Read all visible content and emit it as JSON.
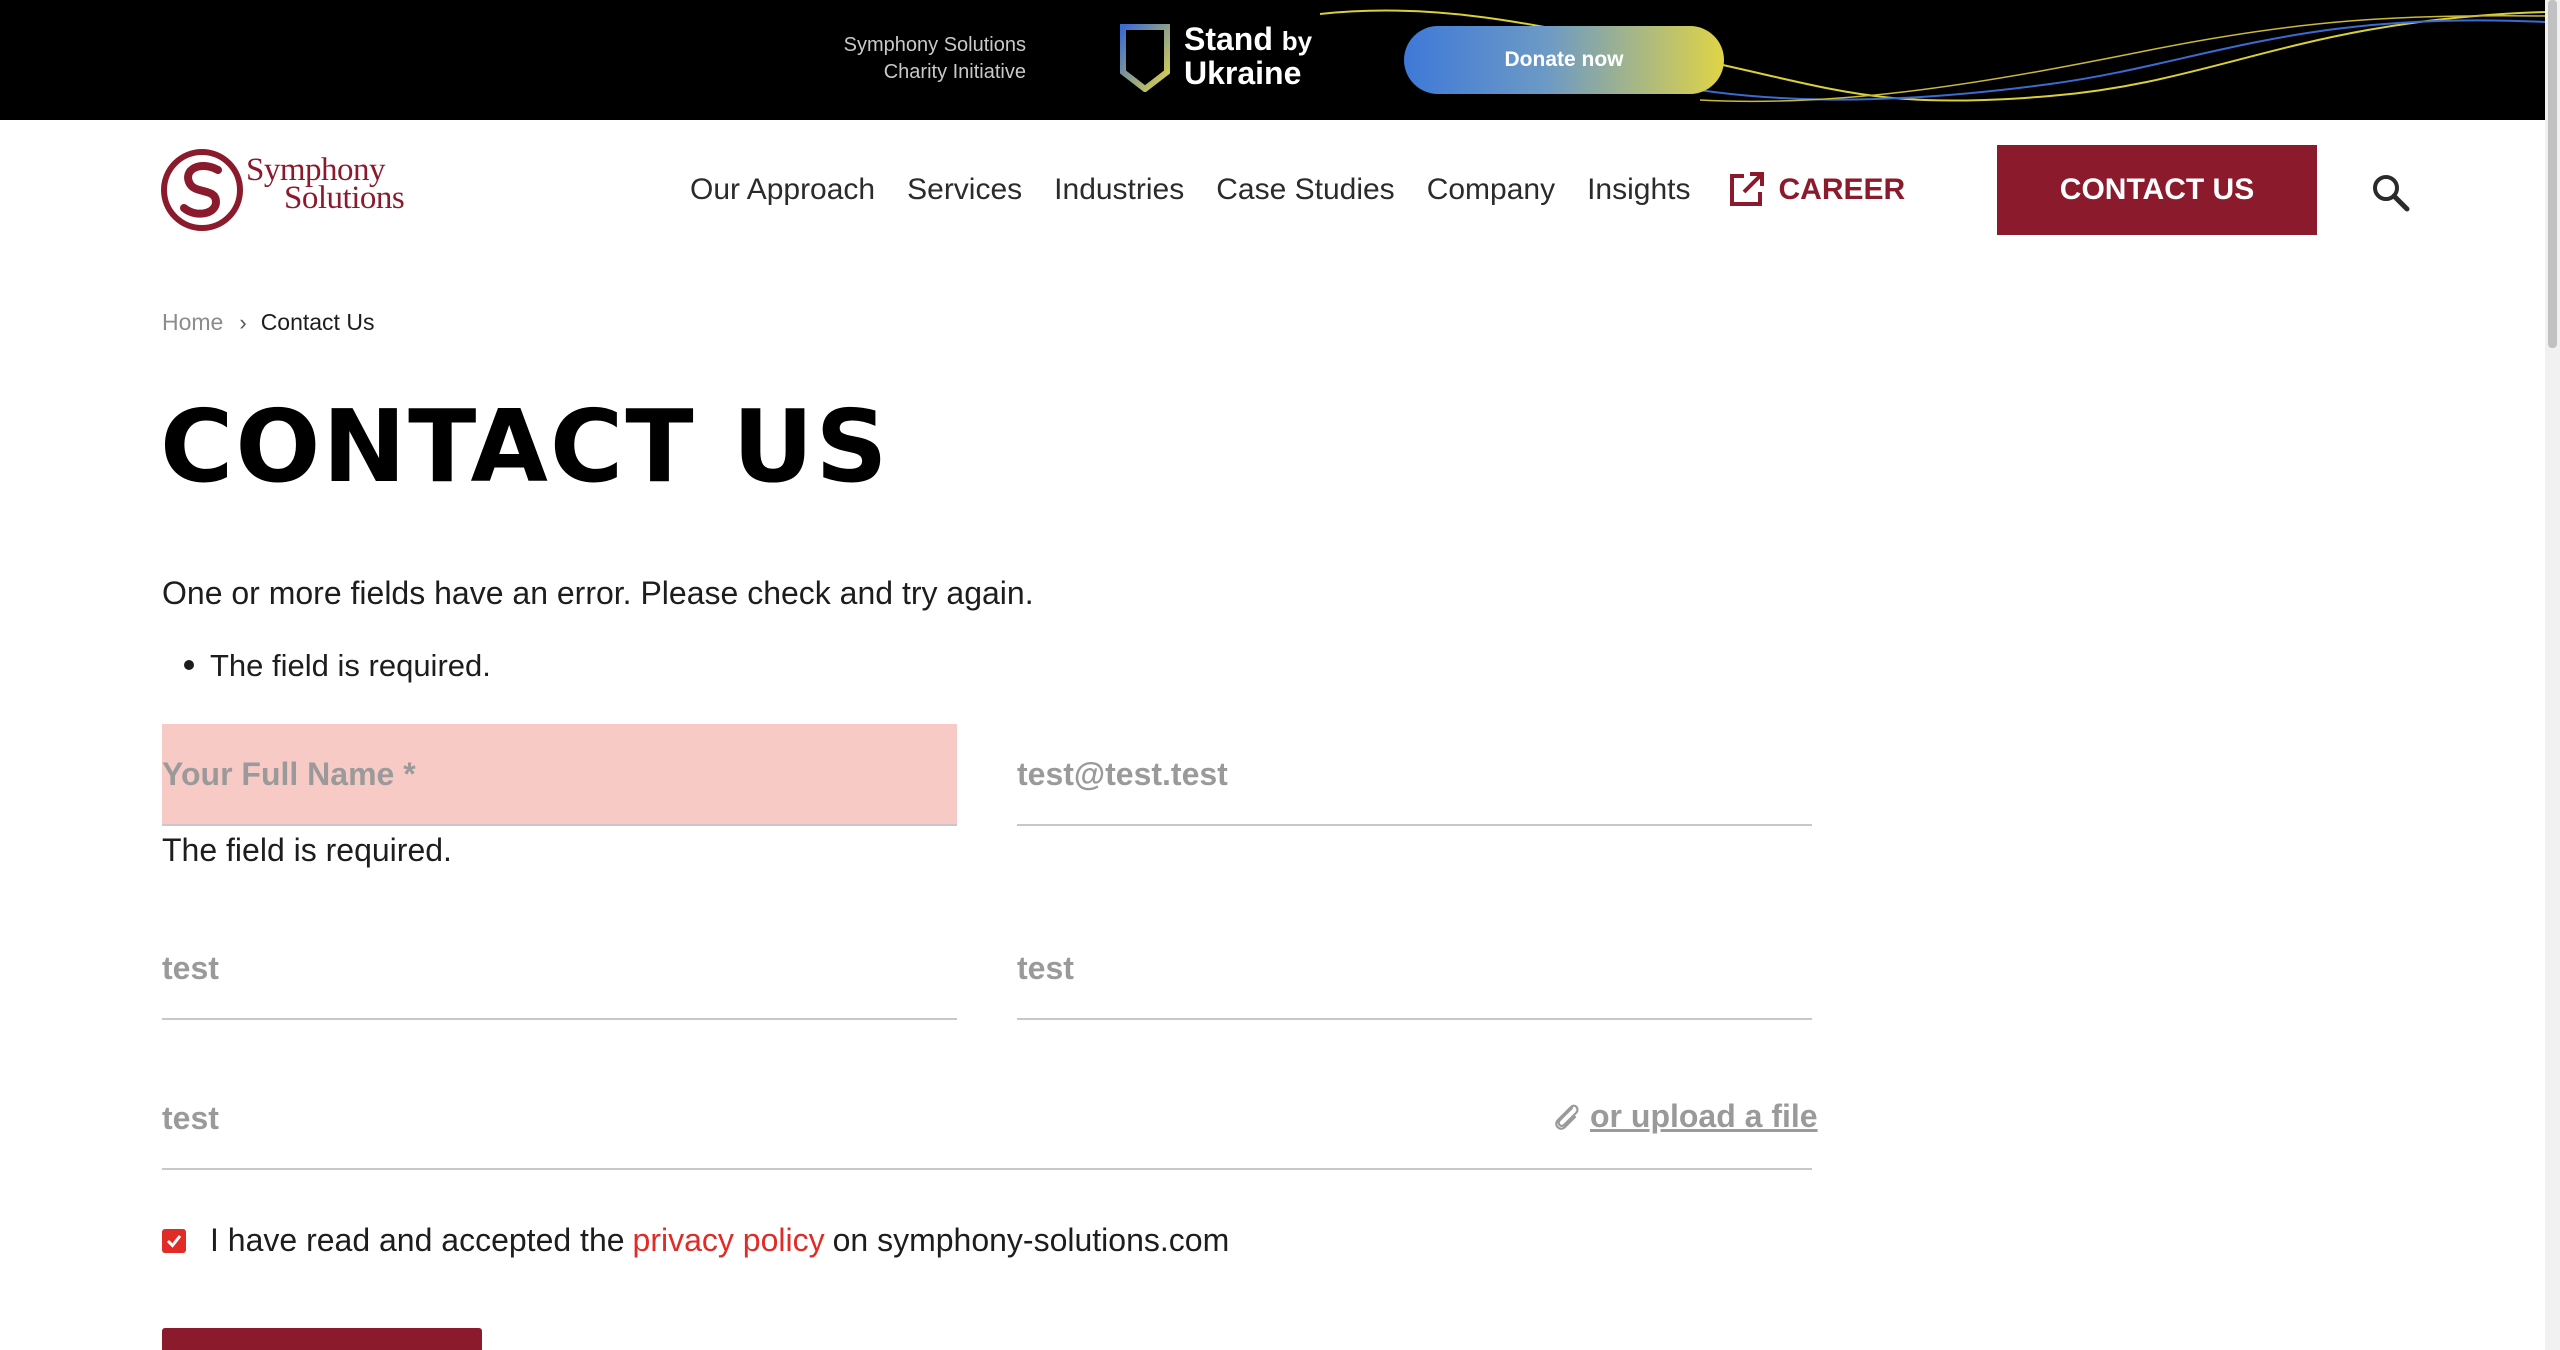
{
  "banner": {
    "charity_line1": "Symphony Solutions",
    "charity_line2": "Charity Initiative",
    "stand": "Stand",
    "by": "by",
    "ukraine": "Ukraine",
    "donate_label": "Donate now"
  },
  "header": {
    "logo_line1": "Symphony",
    "logo_line2": "Solutions",
    "nav": [
      "Our Approach",
      "Services",
      "Industries",
      "Case Studies",
      "Company",
      "Insights"
    ],
    "career_label": "CAREER",
    "contact_label": "CONTACT US"
  },
  "breadcrumb": {
    "home": "Home",
    "separator": "›",
    "current": "Contact Us"
  },
  "page": {
    "title": "CONTACT US",
    "error_message": "One or more fields have an error. Please check and try again.",
    "error_items": [
      "The field is required."
    ]
  },
  "form": {
    "full_name_placeholder": "Your Full Name *",
    "full_name_error": "The field is required.",
    "email_value": "test@test.test",
    "field3_value": "test",
    "field4_value": "test",
    "message_value": "test",
    "upload_label": " or upload a file",
    "consent_before": "I have read and accepted the",
    "consent_link": "privacy policy",
    "consent_after": "on symphony-solutions.com",
    "consent_checked": true
  },
  "colors": {
    "brand": "#8b1a2c",
    "error_field_bg": "#f8cac6",
    "link_red": "#e02b27",
    "donate_gradient_start": "#3e79d8",
    "donate_gradient_end": "#e0d446"
  }
}
